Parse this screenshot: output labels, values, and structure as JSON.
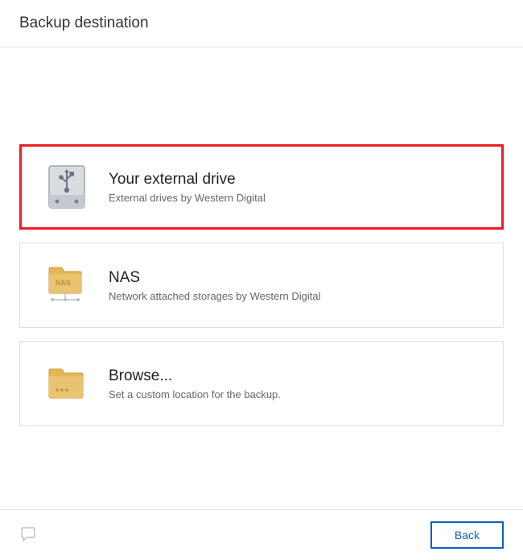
{
  "header": {
    "title": "Backup destination"
  },
  "options": {
    "external_drive": {
      "title": "Your external drive",
      "description": "External drives by Western Digital"
    },
    "nas": {
      "title": "NAS",
      "description": "Network attached storages by Western Digital",
      "badge": "NAS"
    },
    "browse": {
      "title": "Browse...",
      "description": "Set a custom location for the backup."
    }
  },
  "footer": {
    "back_label": "Back"
  }
}
